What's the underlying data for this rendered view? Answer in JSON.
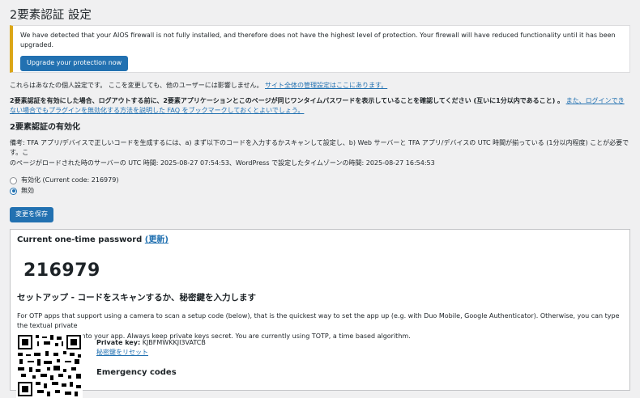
{
  "page": {
    "title": "2要素認証 設定"
  },
  "notice": {
    "message": "We have detected that your AIOS firewall is not fully installed, and therefore does not have the highest level of protection. Your firewall will have reduced functionality until it has been upgraded.",
    "button_label": "Upgrade your protection now"
  },
  "intro": {
    "text": "これらはあなたの個人設定です。 ここを変更しても、他のユーザーには影響しません。",
    "link": "サイト全体の管理設定はここにあります。"
  },
  "warning": {
    "bold": "2要素認証を有効にした場合、ログアウトする前に、2要素アプリケーションとこのページが同じワンタイムパスワードを表示していることを確認してください (互いに1分以内であること) 。",
    "link": "また、ログインできない場合でもプラグインを無効化する方法を説明した FAQ をブックマークしておくとよいでしょう。"
  },
  "enable": {
    "heading": "2要素認証の有効化",
    "note_line1": "備考: TFA アプリ/デバイスで正しいコードを生成するには、a) まず以下のコードを入力するかスキャンして設定し、b) Web サーバーと TFA アプリ/デバイスの UTC 時間が揃っている (1分以内程度) ことが必要です。こ",
    "note_line2": "のページがロードされた時のサーバーの UTC 時間: 2025-08-27 07:54:53、WordPress で設定したタイムゾーンの時間: 2025-08-27 16:54:53",
    "options": [
      {
        "label": "有効化 (Current code: 216979)",
        "checked": false
      },
      {
        "label": "無効",
        "checked": true
      }
    ],
    "save_label": "変更を保存"
  },
  "otp": {
    "heading": "Current one-time password",
    "refresh_link": "(更新)",
    "code": "216979"
  },
  "setup": {
    "heading": "セットアップ - コードをスキャンするか、秘密鍵を入力します",
    "desc_line1": "For OTP apps that support using a camera to scan a setup code (below), that is the quickest way to set the app up (e.g. with Duo Mobile, Google Authenticator). Otherwise, you can type the textual private",
    "desc_line2": "key (shown below) into your app. Always keep private keys secret. You are currently using TOTP, a time based algorithm.",
    "private_key_label": "Private key:",
    "private_key_value": "KJBFMWKKJI3VATCB",
    "reset_link": "秘密鍵をリセット",
    "emergency_heading": "Emergency codes"
  },
  "colors": {
    "accent": "#2271b1",
    "notice_border": "#dba617"
  }
}
